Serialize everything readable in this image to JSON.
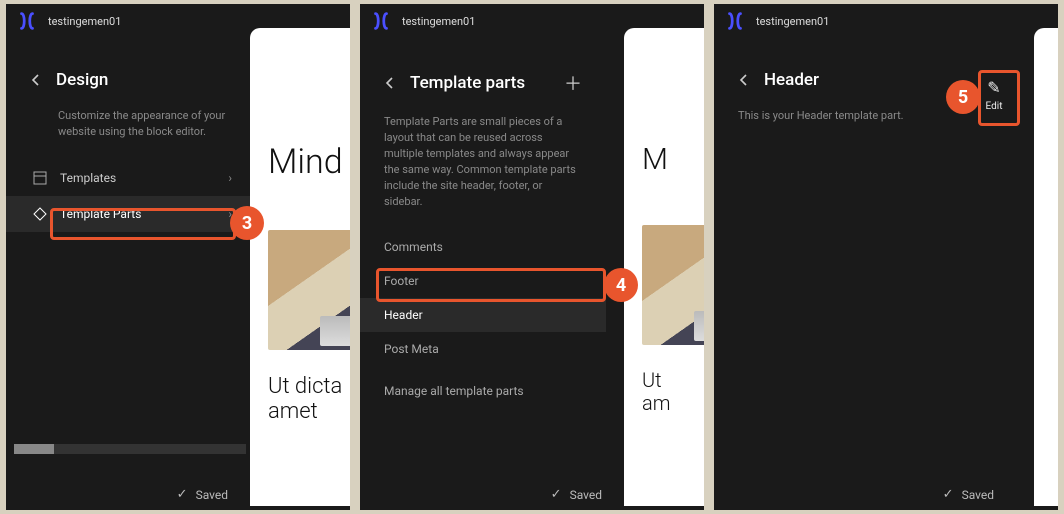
{
  "site_name": "testingemen01",
  "saved_label": "Saved",
  "panel_design": {
    "title": "Design",
    "description": "Customize the appearance of your website using the block editor.",
    "nav": {
      "templates": "Templates",
      "template_parts": "Template Parts"
    }
  },
  "panel_parts": {
    "title": "Template parts",
    "description": "Template Parts are small pieces of a layout that can be reused across multiple templates and always appear the same way. Common template parts include the site header, footer, or sidebar.",
    "items": {
      "comments": "Comments",
      "footer": "Footer",
      "header": "Header",
      "post_meta": "Post Meta"
    },
    "manage": "Manage all template parts"
  },
  "panel_header": {
    "title": "Header",
    "description": "This is your Header template part.",
    "edit": "Edit"
  },
  "preview": {
    "heading": "Mind",
    "heading_short": "M",
    "sub1": "Ut dicta\namet",
    "sub2": "Ut\nam"
  },
  "badges": {
    "three": "3",
    "four": "4",
    "five": "5"
  }
}
